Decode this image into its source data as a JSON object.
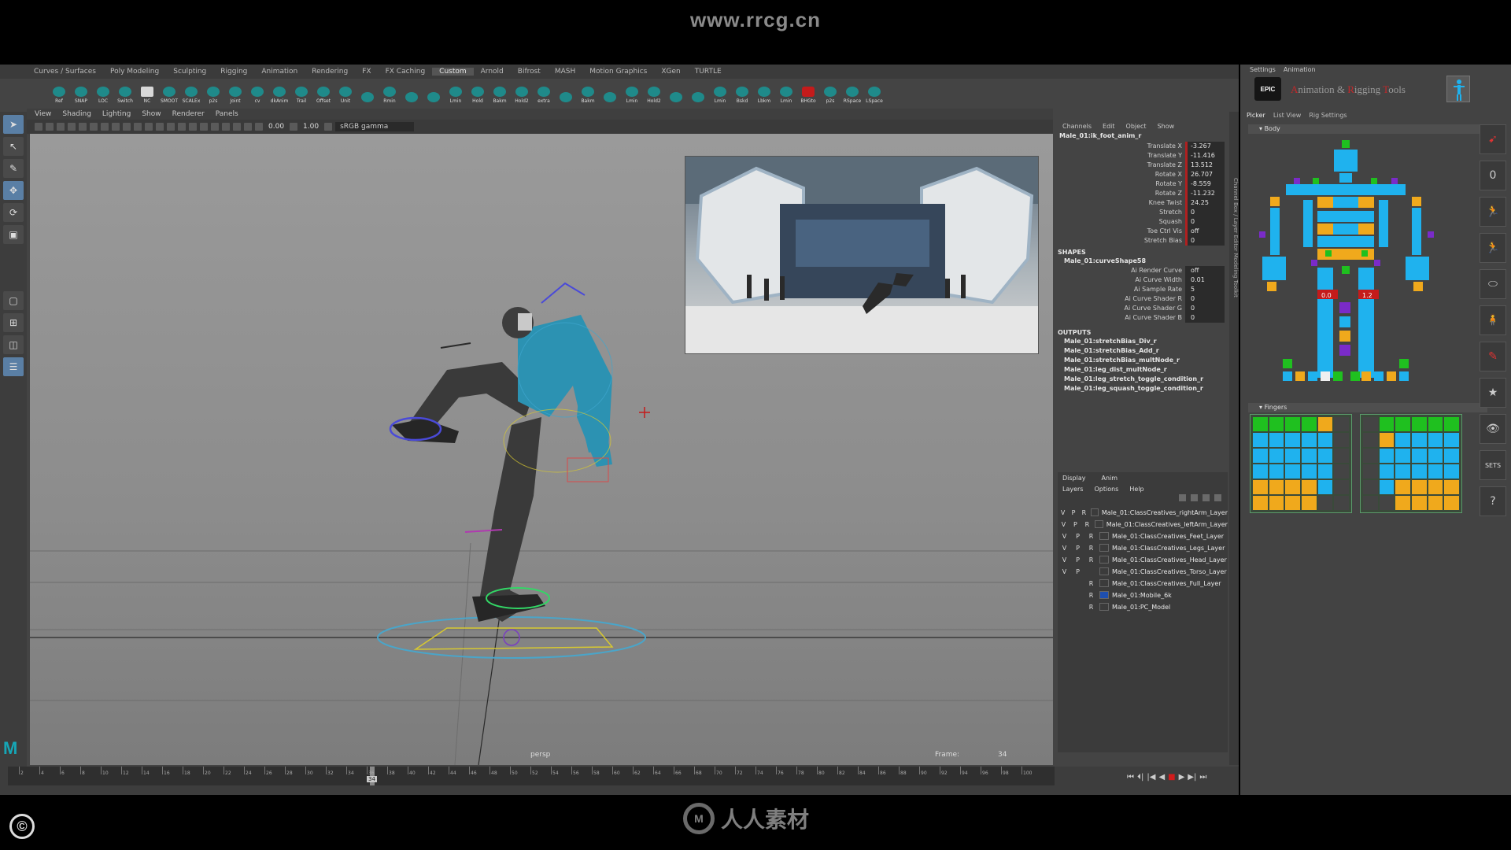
{
  "watermark": "www.rrcg.cn",
  "shelf": {
    "tabs": [
      "Curves / Surfaces",
      "Poly Modeling",
      "Sculpting",
      "Rigging",
      "Animation",
      "Rendering",
      "FX",
      "FX Caching",
      "Custom",
      "Arnold",
      "Bifrost",
      "MASH",
      "Motion Graphics",
      "XGen",
      "TURTLE"
    ],
    "active_tab": "Custom",
    "buttons": [
      "Ref",
      "SNAP",
      "LOC",
      "Switch",
      "NC",
      "SMOOT",
      "SCALEx",
      "p2s",
      "Joint",
      "cv",
      "dkAnim",
      "Trail",
      "Offset",
      "Unit",
      "",
      "Rmin",
      "",
      "",
      "Lmin",
      "Hold",
      "Bakm",
      "Hold2",
      "extra",
      "",
      "Bakm",
      "",
      "Lmin",
      "Hold2",
      "",
      "",
      "Lmin",
      "Bskd",
      "Lbkm",
      "Lmin",
      "BHGto",
      "p2s",
      "RSpace",
      "LSpace"
    ]
  },
  "viewport": {
    "menu": [
      "View",
      "Shading",
      "Lighting",
      "Show",
      "Renderer",
      "Panels"
    ],
    "field_a": "0.00",
    "field_b": "1.00",
    "color_space": "sRGB gamma",
    "camera": "persp",
    "frame_label": "Frame:",
    "frame_value": "34"
  },
  "channel_box": {
    "menu": [
      "Channels",
      "Edit",
      "Object",
      "Show"
    ],
    "node": "Male_01:ik_foot_anim_r",
    "attributes": [
      {
        "name": "Translate X",
        "value": "-3.267"
      },
      {
        "name": "Translate Y",
        "value": "-11.416"
      },
      {
        "name": "Translate Z",
        "value": "13.512"
      },
      {
        "name": "Rotate X",
        "value": "26.707"
      },
      {
        "name": "Rotate Y",
        "value": "-8.559"
      },
      {
        "name": "Rotate Z",
        "value": "-11.232"
      },
      {
        "name": "Knee Twist",
        "value": "24.25"
      },
      {
        "name": "Stretch",
        "value": "0"
      },
      {
        "name": "Squash",
        "value": "0"
      },
      {
        "name": "Toe Ctrl Vis",
        "value": "off"
      },
      {
        "name": "Stretch Bias",
        "value": "0"
      }
    ],
    "shapes_label": "SHAPES",
    "shape_node": "Male_01:curveShape58",
    "shape_attributes": [
      {
        "name": "Ai Render Curve",
        "value": "off"
      },
      {
        "name": "Ai Curve Width",
        "value": "0.01"
      },
      {
        "name": "Ai Sample Rate",
        "value": "5"
      },
      {
        "name": "Ai Curve Shader R",
        "value": "0"
      },
      {
        "name": "Ai Curve Shader G",
        "value": "0"
      },
      {
        "name": "Ai Curve Shader B",
        "value": "0"
      }
    ],
    "outputs_label": "OUTPUTS",
    "outputs": [
      "Male_01:stretchBias_Div_r",
      "Male_01:stretchBias_Add_r",
      "Male_01:stretchBias_multNode_r",
      "Male_01:leg_dist_multNode_r",
      "Male_01:leg_stretch_toggle_condition_r",
      "Male_01:leg_squash_toggle_condition_r"
    ]
  },
  "layers": {
    "tabs": [
      "Display",
      "Anim"
    ],
    "menu": [
      "Layers",
      "Options",
      "Help"
    ],
    "rows": [
      {
        "v": "V",
        "p": "P",
        "r": "R",
        "name": "Male_01:ClassCreatives_rightArm_Layer"
      },
      {
        "v": "V",
        "p": "P",
        "r": "R",
        "name": "Male_01:ClassCreatives_leftArm_Layer"
      },
      {
        "v": "V",
        "p": "P",
        "r": "R",
        "name": "Male_01:ClassCreatives_Feet_Layer"
      },
      {
        "v": "V",
        "p": "P",
        "r": "R",
        "name": "Male_01:ClassCreatives_Legs_Layer"
      },
      {
        "v": "V",
        "p": "P",
        "r": "R",
        "name": "Male_01:ClassCreatives_Head_Layer"
      },
      {
        "v": "V",
        "p": "P",
        "r": "",
        "name": "Male_01:ClassCreatives_Torso_Layer"
      },
      {
        "v": "",
        "p": "",
        "r": "R",
        "name": "Male_01:ClassCreatives_Full_Layer"
      },
      {
        "v": "",
        "p": "",
        "r": "R",
        "name": "Male_01:Mobile_6k"
      },
      {
        "v": "",
        "p": "",
        "r": "R",
        "name": "Male_01:PC_Model"
      }
    ]
  },
  "side_tabs": "Channel Box / Layer Editor     Modeling Toolkit",
  "timeline": {
    "ticks": [
      "2",
      "4",
      "6",
      "8",
      "10",
      "12",
      "14",
      "16",
      "18",
      "20",
      "22",
      "24",
      "26",
      "28",
      "30",
      "32",
      "34",
      "36",
      "38",
      "40",
      "42",
      "44",
      "46",
      "48",
      "50",
      "52",
      "54",
      "56",
      "58",
      "60",
      "62",
      "64",
      "66",
      "68",
      "70",
      "72",
      "74",
      "76",
      "78",
      "80",
      "82",
      "84",
      "86",
      "88",
      "90",
      "92",
      "94",
      "96",
      "98",
      "100"
    ],
    "current": "34"
  },
  "picker": {
    "menu": [
      "Settings",
      "Animation"
    ],
    "logo": "EPIC",
    "title_parts": [
      {
        "t": "A",
        "red": true
      },
      {
        "t": "nimation",
        "red": false
      },
      {
        "t": " & ",
        "red": false
      },
      {
        "t": "R",
        "red": true
      },
      {
        "t": "igging",
        "red": false
      },
      {
        "t": " ",
        "red": false
      },
      {
        "t": "T",
        "red": true
      },
      {
        "t": "ools",
        "red": false
      }
    ],
    "tabs": [
      "Picker",
      "List View",
      "Rig Settings"
    ],
    "body_label": "Body",
    "fingers_label": "Fingers",
    "ik_left": "0.0",
    "ik_right": "1.2",
    "tool_zero": "0",
    "tool_sets": "SETS",
    "tool_help": "?"
  },
  "colors": {
    "picker_blue": "#1fb2ee",
    "picker_orange": "#f0a91c",
    "picker_green": "#1fc01f",
    "picker_purple": "#7a2bc9",
    "channel_red": "#b02020"
  },
  "bottom_logo": "人人素材",
  "copyright": "©"
}
